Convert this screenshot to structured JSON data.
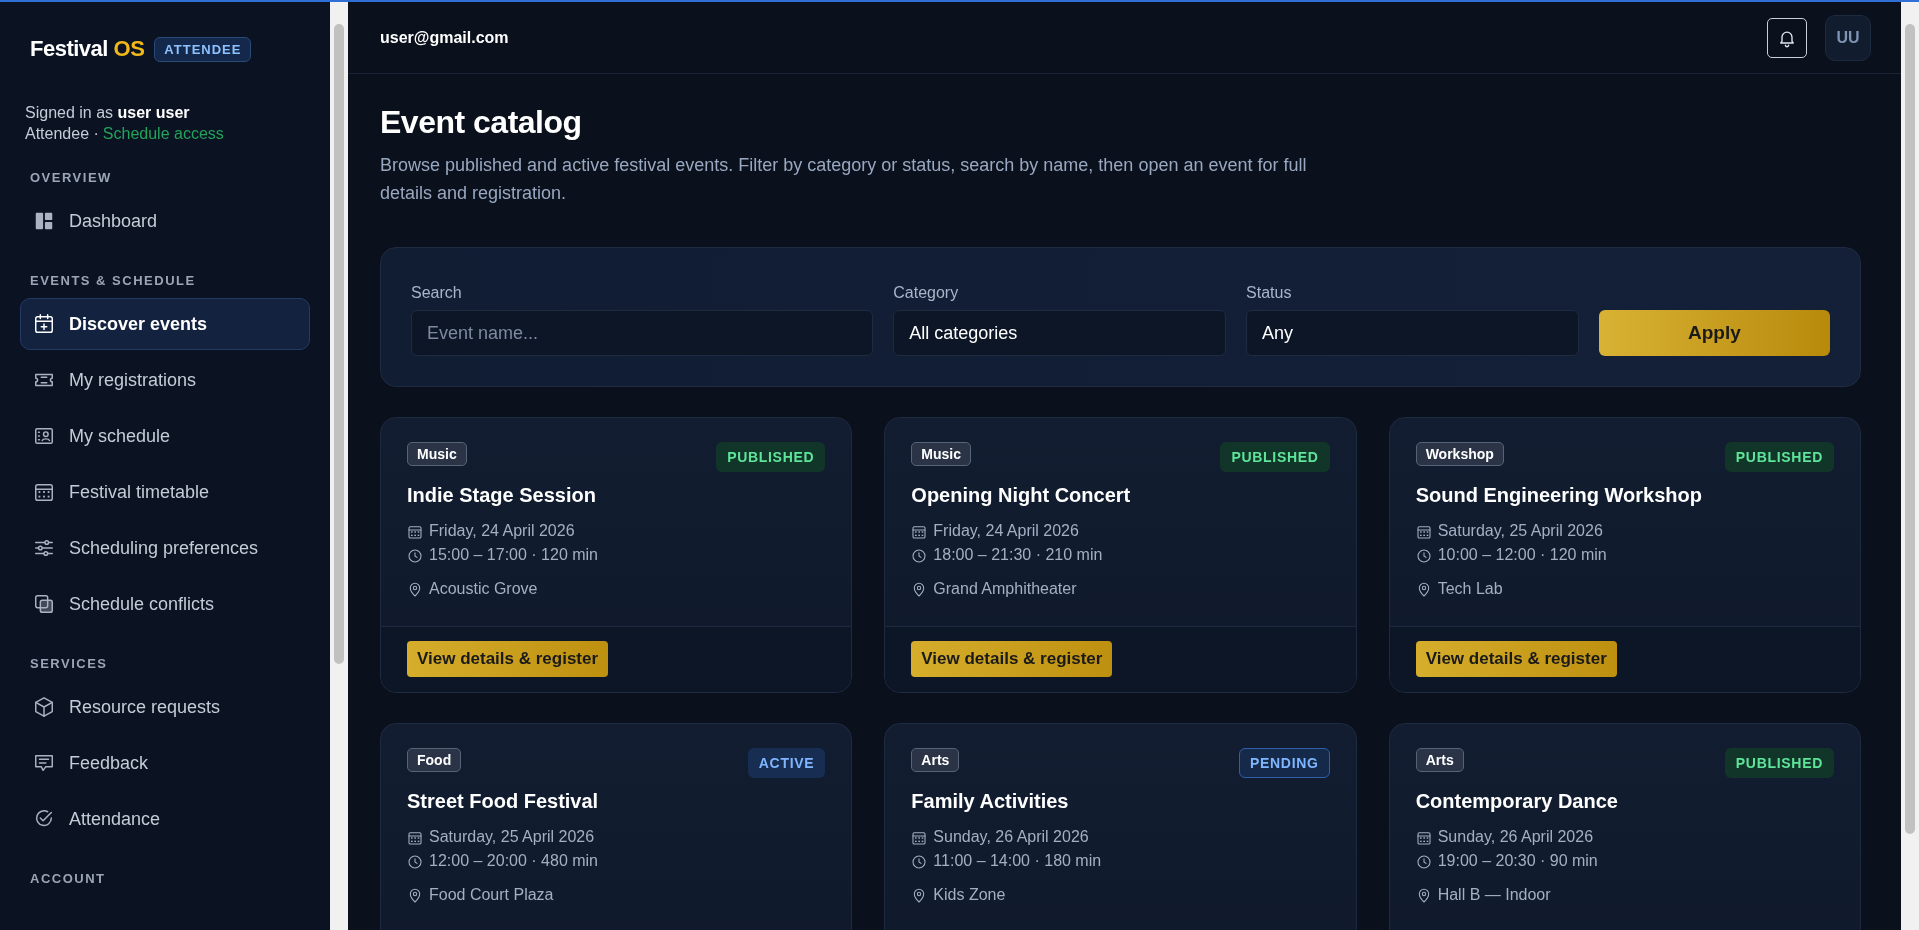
{
  "sidebar": {
    "brand": {
      "name": "Festival",
      "accent": "OS",
      "role_badge": "ATTENDEE"
    },
    "user": {
      "prefix": "Signed in as",
      "name": "user user",
      "role": "Attendee",
      "separator": "·",
      "access": "Schedule access"
    },
    "sections": [
      {
        "title": "OVERVIEW",
        "items": [
          {
            "label": "Dashboard",
            "selected": false
          }
        ]
      },
      {
        "title": "EVENTS & SCHEDULE",
        "items": [
          {
            "label": "Discover events",
            "selected": true
          },
          {
            "label": "My registrations",
            "selected": false
          },
          {
            "label": "My schedule",
            "selected": false
          },
          {
            "label": "Festival timetable",
            "selected": false
          },
          {
            "label": "Scheduling preferences",
            "selected": false
          },
          {
            "label": "Schedule conflicts",
            "selected": false
          }
        ]
      },
      {
        "title": "SERVICES",
        "items": [
          {
            "label": "Resource requests",
            "selected": false
          },
          {
            "label": "Feedback",
            "selected": false
          },
          {
            "label": "Attendance",
            "selected": false
          }
        ]
      },
      {
        "title": "ACCOUNT"
      }
    ]
  },
  "header": {
    "email": "user@gmail.com",
    "avatar": "UU"
  },
  "page": {
    "title": "Event catalog",
    "description": "Browse published and active festival events. Filter by category or status, search by name, then open an event for full details and registration."
  },
  "filters": {
    "search": {
      "label": "Search",
      "placeholder": "Event name..."
    },
    "category": {
      "label": "Category",
      "value": "All categories"
    },
    "status": {
      "label": "Status",
      "value": "Any"
    },
    "apply": "Apply"
  },
  "events": [
    {
      "category": "Music",
      "status": {
        "label": "PUBLISHED",
        "kind": "success"
      },
      "title": "Indie Stage Session",
      "date": "Friday, 24 April 2026",
      "time": "15:00 – 17:00 · 120 min",
      "venue": "Acoustic Grove",
      "action": "View details & register"
    },
    {
      "category": "Music",
      "status": {
        "label": "PUBLISHED",
        "kind": "success"
      },
      "title": "Opening Night Concert",
      "date": "Friday, 24 April 2026",
      "time": "18:00 – 21:30 · 210 min",
      "venue": "Grand Amphitheater",
      "action": "View details & register"
    },
    {
      "category": "Workshop",
      "status": {
        "label": "PUBLISHED",
        "kind": "success"
      },
      "title": "Sound Engineering Workshop",
      "date": "Saturday, 25 April 2026",
      "time": "10:00 – 12:00 · 120 min",
      "venue": "Tech Lab",
      "action": "View details & register"
    },
    {
      "category": "Food",
      "status": {
        "label": "ACTIVE",
        "kind": "info"
      },
      "title": "Street Food Festival",
      "date": "Saturday, 25 April 2026",
      "time": "12:00 – 20:00 · 480 min",
      "venue": "Food Court Plaza"
    },
    {
      "category": "Arts",
      "status": {
        "label": "PENDING",
        "kind": "pending"
      },
      "title": "Family Activities",
      "date": "Sunday, 26 April 2026",
      "time": "11:00 – 14:00 · 180 min",
      "venue": "Kids Zone"
    },
    {
      "category": "Arts",
      "status": {
        "label": "PUBLISHED",
        "kind": "success"
      },
      "title": "Contemporary Dance",
      "date": "Sunday, 26 April 2026",
      "time": "19:00 – 20:30 · 90 min",
      "venue": "Hall B — Indoor"
    }
  ]
}
